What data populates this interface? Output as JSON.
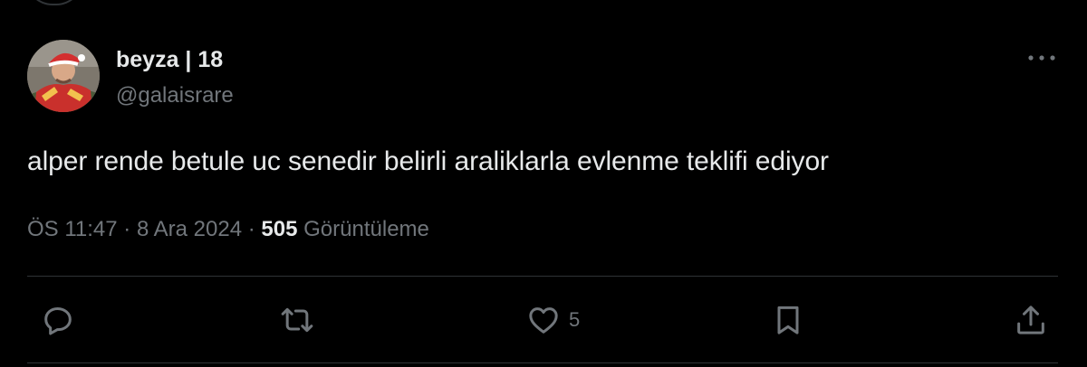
{
  "tweet": {
    "display_name": "beyza | 18",
    "handle": "@galaisrare",
    "text": "alper rende betule uc senedir belirli araliklarla evlenme teklifi ediyor",
    "time": "ÖS 11:47",
    "separator": "·",
    "date": "8 Ara 2024",
    "views_count": "505",
    "views_label": "Görüntüleme"
  },
  "actions": {
    "likes_count": "5"
  },
  "icons": {
    "more": "more-horizontal-icon",
    "reply": "reply-icon",
    "retweet": "retweet-icon",
    "like": "heart-icon",
    "bookmark": "bookmark-icon",
    "share": "share-icon"
  },
  "colors": {
    "background": "#000000",
    "primary_text": "#e7e9ea",
    "secondary_text": "#71767b",
    "divider": "#2f3336"
  }
}
